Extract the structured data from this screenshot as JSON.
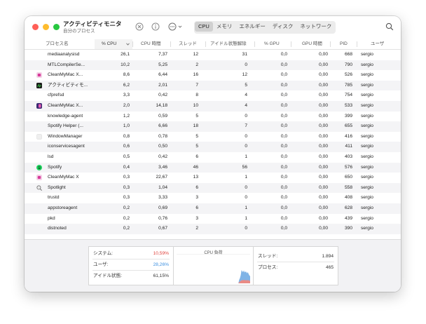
{
  "window": {
    "title": "アクティビティモニタ",
    "subtitle": "自分のプロセス"
  },
  "toolbar": {
    "stop_icon": "stop-process-icon",
    "info_icon": "info-icon",
    "more_icon": "ellipsis-icon",
    "search_icon": "search-icon",
    "tabs": [
      "CPU",
      "メモリ",
      "エネルギー",
      "ディスク",
      "ネットワーク"
    ],
    "active_tab": "CPU"
  },
  "table": {
    "headers": [
      "プロセス名",
      "% CPU",
      "CPU 時間",
      "スレッド",
      "アイドル状態解除",
      "% GPU",
      "GPU 時間",
      "PID",
      "ユーザ"
    ],
    "rows": [
      {
        "name": "mediaanalysisd",
        "cpu": "26,1",
        "cpu_time": "7,37",
        "threads": "12",
        "idle_wakeups": "31",
        "gpu": "0,0",
        "gpu_time": "0,00",
        "pid": "668",
        "user": "sergio",
        "icon": "none"
      },
      {
        "name": "MTLCompilerSe...",
        "cpu": "10,2",
        "cpu_time": "5,25",
        "threads": "2",
        "idle_wakeups": "0",
        "gpu": "0,0",
        "gpu_time": "0,00",
        "pid": "790",
        "user": "sergio",
        "icon": "none"
      },
      {
        "name": "CleanMyMac X...",
        "cpu": "8,6",
        "cpu_time": "6,44",
        "threads": "16",
        "idle_wakeups": "12",
        "gpu": "0,0",
        "gpu_time": "0,00",
        "pid": "526",
        "user": "sergio",
        "icon": "cleanmymac-icon"
      },
      {
        "name": "アクティビティモ...",
        "cpu": "6,2",
        "cpu_time": "2,01",
        "threads": "7",
        "idle_wakeups": "5",
        "gpu": "0,0",
        "gpu_time": "0,00",
        "pid": "785",
        "user": "sergio",
        "icon": "activity-monitor-icon"
      },
      {
        "name": "cfprefsd",
        "cpu": "3,3",
        "cpu_time": "0,42",
        "threads": "8",
        "idle_wakeups": "4",
        "gpu": "0,0",
        "gpu_time": "0,00",
        "pid": "754",
        "user": "sergio",
        "icon": "none"
      },
      {
        "name": "CleanMyMac X...",
        "cpu": "2,0",
        "cpu_time": "14,18",
        "threads": "10",
        "idle_wakeups": "4",
        "gpu": "0,0",
        "gpu_time": "0,00",
        "pid": "533",
        "user": "sergio",
        "icon": "cleanmymac-menu-icon"
      },
      {
        "name": "knowledge-agent",
        "cpu": "1,2",
        "cpu_time": "0,59",
        "threads": "5",
        "idle_wakeups": "0",
        "gpu": "0,0",
        "gpu_time": "0,00",
        "pid": "399",
        "user": "sergio",
        "icon": "none"
      },
      {
        "name": "Spotify Helper (...",
        "cpu": "1,0",
        "cpu_time": "6,66",
        "threads": "18",
        "idle_wakeups": "7",
        "gpu": "0,0",
        "gpu_time": "0,00",
        "pid": "655",
        "user": "sergio",
        "icon": "none"
      },
      {
        "name": "WindowManager",
        "cpu": "0,8",
        "cpu_time": "0,78",
        "threads": "5",
        "idle_wakeups": "0",
        "gpu": "0,0",
        "gpu_time": "0,00",
        "pid": "416",
        "user": "sergio",
        "icon": "window-manager-icon"
      },
      {
        "name": "iconservicesagent",
        "cpu": "0,6",
        "cpu_time": "0,50",
        "threads": "5",
        "idle_wakeups": "0",
        "gpu": "0,0",
        "gpu_time": "0,00",
        "pid": "411",
        "user": "sergio",
        "icon": "none"
      },
      {
        "name": "lsd",
        "cpu": "0,5",
        "cpu_time": "0,42",
        "threads": "6",
        "idle_wakeups": "1",
        "gpu": "0,0",
        "gpu_time": "0,00",
        "pid": "403",
        "user": "sergio",
        "icon": "none"
      },
      {
        "name": "Spotify",
        "cpu": "0,4",
        "cpu_time": "3,46",
        "threads": "46",
        "idle_wakeups": "56",
        "gpu": "0,0",
        "gpu_time": "0,00",
        "pid": "576",
        "user": "sergio",
        "icon": "spotify-icon"
      },
      {
        "name": "CleanMyMac X",
        "cpu": "0,3",
        "cpu_time": "22,67",
        "threads": "13",
        "idle_wakeups": "1",
        "gpu": "0,0",
        "gpu_time": "0,00",
        "pid": "650",
        "user": "sergio",
        "icon": "cleanmymac-icon"
      },
      {
        "name": "Spotlight",
        "cpu": "0,3",
        "cpu_time": "1,04",
        "threads": "6",
        "idle_wakeups": "0",
        "gpu": "0,0",
        "gpu_time": "0,00",
        "pid": "558",
        "user": "sergio",
        "icon": "spotlight-icon"
      },
      {
        "name": "trustd",
        "cpu": "0,3",
        "cpu_time": "3,33",
        "threads": "3",
        "idle_wakeups": "0",
        "gpu": "0,0",
        "gpu_time": "0,00",
        "pid": "408",
        "user": "sergio",
        "icon": "none"
      },
      {
        "name": "appstoreagent",
        "cpu": "0,2",
        "cpu_time": "0,69",
        "threads": "6",
        "idle_wakeups": "1",
        "gpu": "0,0",
        "gpu_time": "0,00",
        "pid": "628",
        "user": "sergio",
        "icon": "none"
      },
      {
        "name": "pkd",
        "cpu": "0,2",
        "cpu_time": "0,76",
        "threads": "3",
        "idle_wakeups": "1",
        "gpu": "0,0",
        "gpu_time": "0,00",
        "pid": "439",
        "user": "sergio",
        "icon": "none"
      },
      {
        "name": "distnoted",
        "cpu": "0,2",
        "cpu_time": "0,67",
        "threads": "2",
        "idle_wakeups": "0",
        "gpu": "0,0",
        "gpu_time": "0,00",
        "pid": "390",
        "user": "sergio",
        "icon": "none"
      }
    ]
  },
  "summary": {
    "system_label": "システム:",
    "system_value": "10,59%",
    "user_label": "ユーザ:",
    "user_value": "28,26%",
    "idle_label": "アイドル状態:",
    "idle_value": "61,15%",
    "cpu_load_title": "CPU 負荷",
    "threads_label": "スレッド:",
    "threads_value": "1.894",
    "processes_label": "プロセス:",
    "processes_value": "465"
  },
  "colors": {
    "system": "#e0443e",
    "user": "#3b8fe0",
    "chart_user": "#7fb3e6",
    "chart_system": "#e98b86"
  },
  "chart_data": {
    "type": "area",
    "title": "CPU 負荷",
    "ylim": [
      0,
      100
    ],
    "series": [
      {
        "name": "ユーザ",
        "values": [
          0,
          0,
          0,
          0,
          0,
          0,
          0,
          0,
          0,
          0,
          0,
          0,
          0,
          0,
          0,
          0,
          0,
          0,
          0,
          0,
          0,
          0,
          0,
          0,
          0,
          0,
          0,
          0,
          0,
          0,
          0,
          0,
          0,
          0,
          0,
          0,
          0,
          0,
          0,
          0,
          0,
          0,
          0,
          0,
          0,
          0,
          0,
          0,
          0,
          0,
          0,
          0,
          0,
          0,
          0,
          0,
          0,
          0,
          0,
          0,
          0,
          0,
          0,
          0,
          0,
          0,
          0,
          0,
          0,
          0,
          0,
          0,
          0,
          0,
          0,
          0,
          0,
          0,
          0,
          0,
          8,
          12,
          20,
          35,
          30,
          28,
          32,
          26,
          30,
          28,
          24,
          27,
          22,
          18,
          16
        ]
      },
      {
        "name": "システム",
        "values": [
          0,
          0,
          0,
          0,
          0,
          0,
          0,
          0,
          0,
          0,
          0,
          0,
          0,
          0,
          0,
          0,
          0,
          0,
          0,
          0,
          0,
          0,
          0,
          0,
          0,
          0,
          0,
          0,
          0,
          0,
          0,
          0,
          0,
          0,
          0,
          0,
          0,
          0,
          0,
          0,
          0,
          0,
          0,
          0,
          0,
          0,
          0,
          0,
          0,
          0,
          0,
          0,
          0,
          0,
          0,
          0,
          0,
          0,
          0,
          0,
          0,
          0,
          0,
          0,
          0,
          0,
          0,
          0,
          0,
          0,
          0,
          0,
          0,
          0,
          0,
          0,
          0,
          0,
          0,
          0,
          4,
          6,
          8,
          10,
          11,
          10,
          12,
          11,
          10,
          11,
          10,
          11,
          10,
          9,
          8
        ]
      }
    ]
  }
}
